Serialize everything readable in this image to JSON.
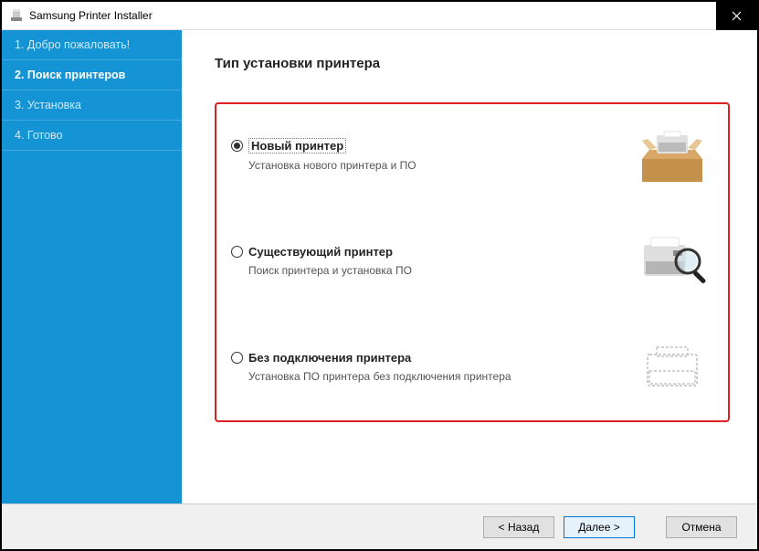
{
  "window": {
    "title": "Samsung Printer Installer"
  },
  "sidebar": {
    "items": [
      {
        "label": "1. Добро пожаловать!"
      },
      {
        "label": "2. Поиск принтеров"
      },
      {
        "label": "3. Установка"
      },
      {
        "label": "4. Готово"
      }
    ]
  },
  "page": {
    "title": "Тип установки принтера"
  },
  "options": [
    {
      "label": "Новый принтер",
      "desc": "Установка нового принтера и ПО",
      "icon": "printer-in-box"
    },
    {
      "label": "Существующий принтер",
      "desc": "Поиск принтера и установка ПО",
      "icon": "printer-with-magnifier"
    },
    {
      "label": "Без подключения принтера",
      "desc": "Установка ПО принтера без подключения принтера",
      "icon": "printer-outline"
    }
  ],
  "footer": {
    "back": "< Назад",
    "next": "Далее >",
    "cancel": "Отмена"
  }
}
